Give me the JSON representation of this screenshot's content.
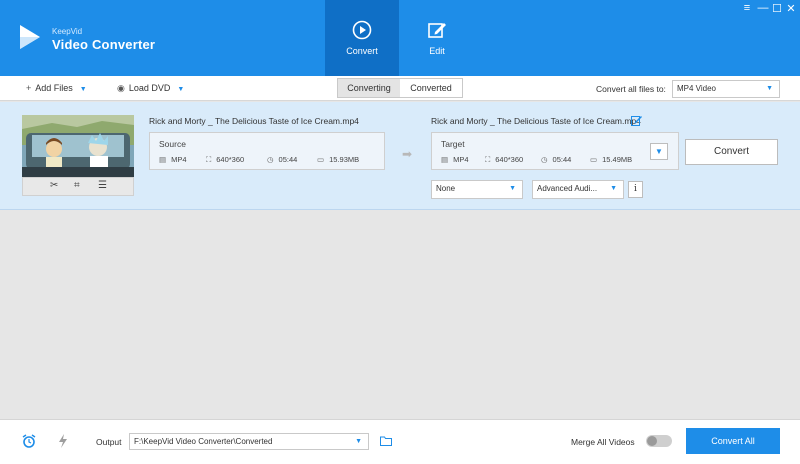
{
  "app": {
    "brand_small": "KeepVid",
    "brand_name": "Video Converter"
  },
  "top_tabs": [
    {
      "label": "Convert",
      "active": true
    },
    {
      "label": "Edit",
      "active": false
    }
  ],
  "window_controls": {
    "restore": "≡",
    "minimize": "—",
    "maximize": "☐",
    "close": "✕"
  },
  "toolbar": {
    "add_files": "Add Files",
    "load_dvd": "Load DVD",
    "segments": [
      "Converting",
      "Converted"
    ],
    "convert_all_label": "Convert all files to:",
    "convert_all_value": "MP4 Video"
  },
  "file": {
    "source_name": "Rick and Morty _ The Delicious Taste of Ice Cream.mp4",
    "target_name": "Rick and Morty _ The Delicious Taste of Ice Cream.mp4",
    "source": {
      "title": "Source",
      "format": "MP4",
      "resolution": "640*360",
      "duration": "05:44",
      "size": "15.93MB"
    },
    "target": {
      "title": "Target",
      "format": "MP4",
      "resolution": "640*360",
      "duration": "05:44",
      "size": "15.49MB"
    },
    "subtitle_value": "None",
    "audio_value": "Advanced Audi...",
    "convert_button": "Convert",
    "info_button": "i"
  },
  "footer": {
    "output_label": "Output",
    "output_path": "F:\\KeepVid Video Converter\\Converted",
    "merge_label": "Merge All Videos",
    "merge_on": false,
    "convert_all_button": "Convert All"
  },
  "colors": {
    "accent": "#1e8de8",
    "header_active": "#0f6fc6",
    "row_bg": "#d9ebfa",
    "empty_bg": "#e6e6e6"
  }
}
